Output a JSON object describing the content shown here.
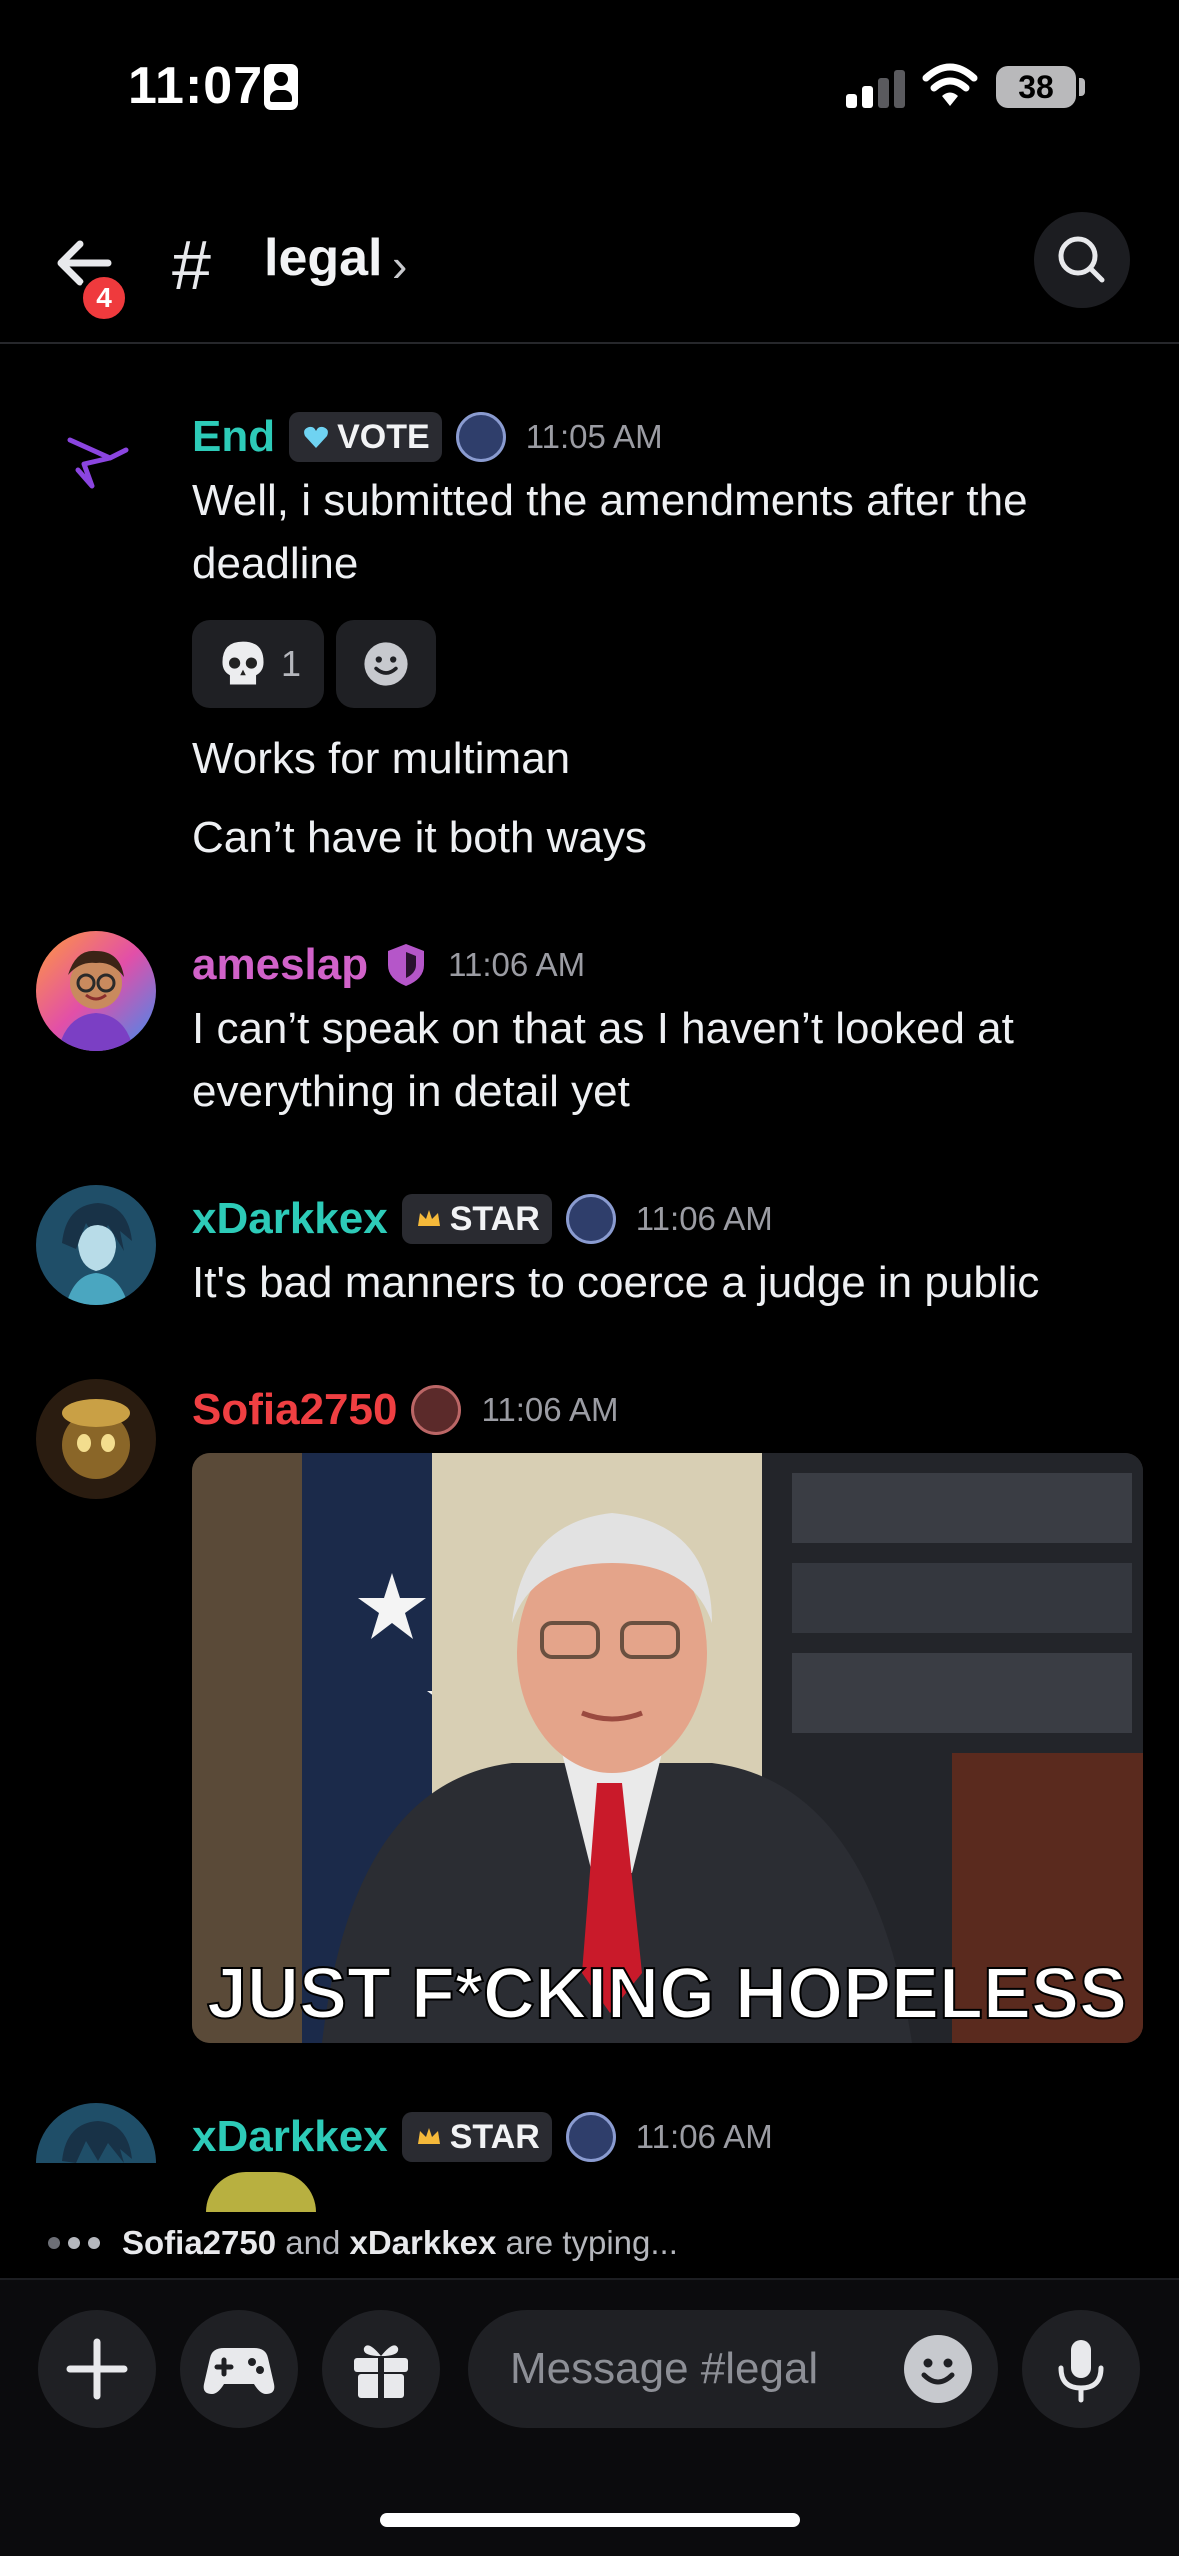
{
  "status_bar": {
    "time": "11:07",
    "battery": "38"
  },
  "header": {
    "unread_badge": "4",
    "channel_name": "legal"
  },
  "messages": [
    {
      "author": "End",
      "author_color": "#2dcbb8",
      "tag": "VOTE",
      "timestamp": "11:05 AM",
      "lines": [
        "Well, i submitted the amendments after the",
        "deadline"
      ],
      "reactions": [
        {
          "emoji": "skull",
          "count": "1"
        }
      ],
      "followups": [
        "Works for multiman",
        "Can’t have it both ways"
      ]
    },
    {
      "author": "ameslap",
      "author_color": "#d162c9",
      "timestamp": "11:06 AM",
      "lines": [
        "I can’t speak on that as I haven’t looked at",
        "everything in detail yet"
      ]
    },
    {
      "author": "xDarkkex",
      "author_color": "#2dcbb8",
      "tag": "STAR",
      "timestamp": "11:06 AM",
      "lines": [
        "It's bad manners to coerce a judge in public"
      ]
    },
    {
      "author": "Sofia2750",
      "author_color": "#ef3f42",
      "timestamp": "11:06 AM",
      "gif_caption": "JUST F*CKING HOPELESS"
    },
    {
      "author": "xDarkkex",
      "author_color": "#2dcbb8",
      "tag": "STAR",
      "timestamp": "11:06 AM"
    }
  ],
  "typing": {
    "user1": "Sofia2750",
    "joiner": "and",
    "user2": "xDarkkex",
    "suffix": "are typing..."
  },
  "composer": {
    "placeholder": "Message #legal"
  },
  "colors": {
    "accent_teal": "#2dcbb8",
    "accent_pink": "#d162c9",
    "accent_red": "#ef3f42",
    "badge_red": "#ef3a3d"
  }
}
